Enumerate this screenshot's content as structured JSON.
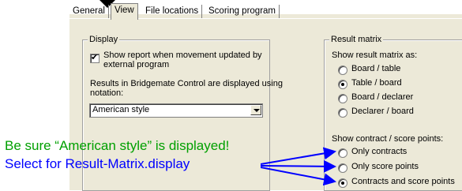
{
  "tabs": [
    "General",
    "View",
    "File locations",
    "Scoring program"
  ],
  "display_group": {
    "title": "Display",
    "checkbox_label_line1": "Show report when movement updated by",
    "checkbox_label_line2": "external program",
    "notation_label_line1": "Results in Bridgemate Control are displayed using",
    "notation_label_line2": "notation:",
    "notation_value": "American style"
  },
  "result_matrix": {
    "title": "Result matrix",
    "show_as_label": "Show result matrix as:",
    "show_as_options": [
      "Board / table",
      "Table / board",
      "Board / declarer",
      "Declarer / board"
    ],
    "show_points_label": "Show contract / score points:",
    "points_options": [
      "Only contracts",
      "Only score points",
      "Contracts and score points"
    ]
  },
  "annotations": {
    "note1": "Be sure “American style” is displayed!",
    "note2": "Select for Result-Matrix.display",
    "note1_color": "#00a000",
    "note2_color": "#0000ff"
  }
}
